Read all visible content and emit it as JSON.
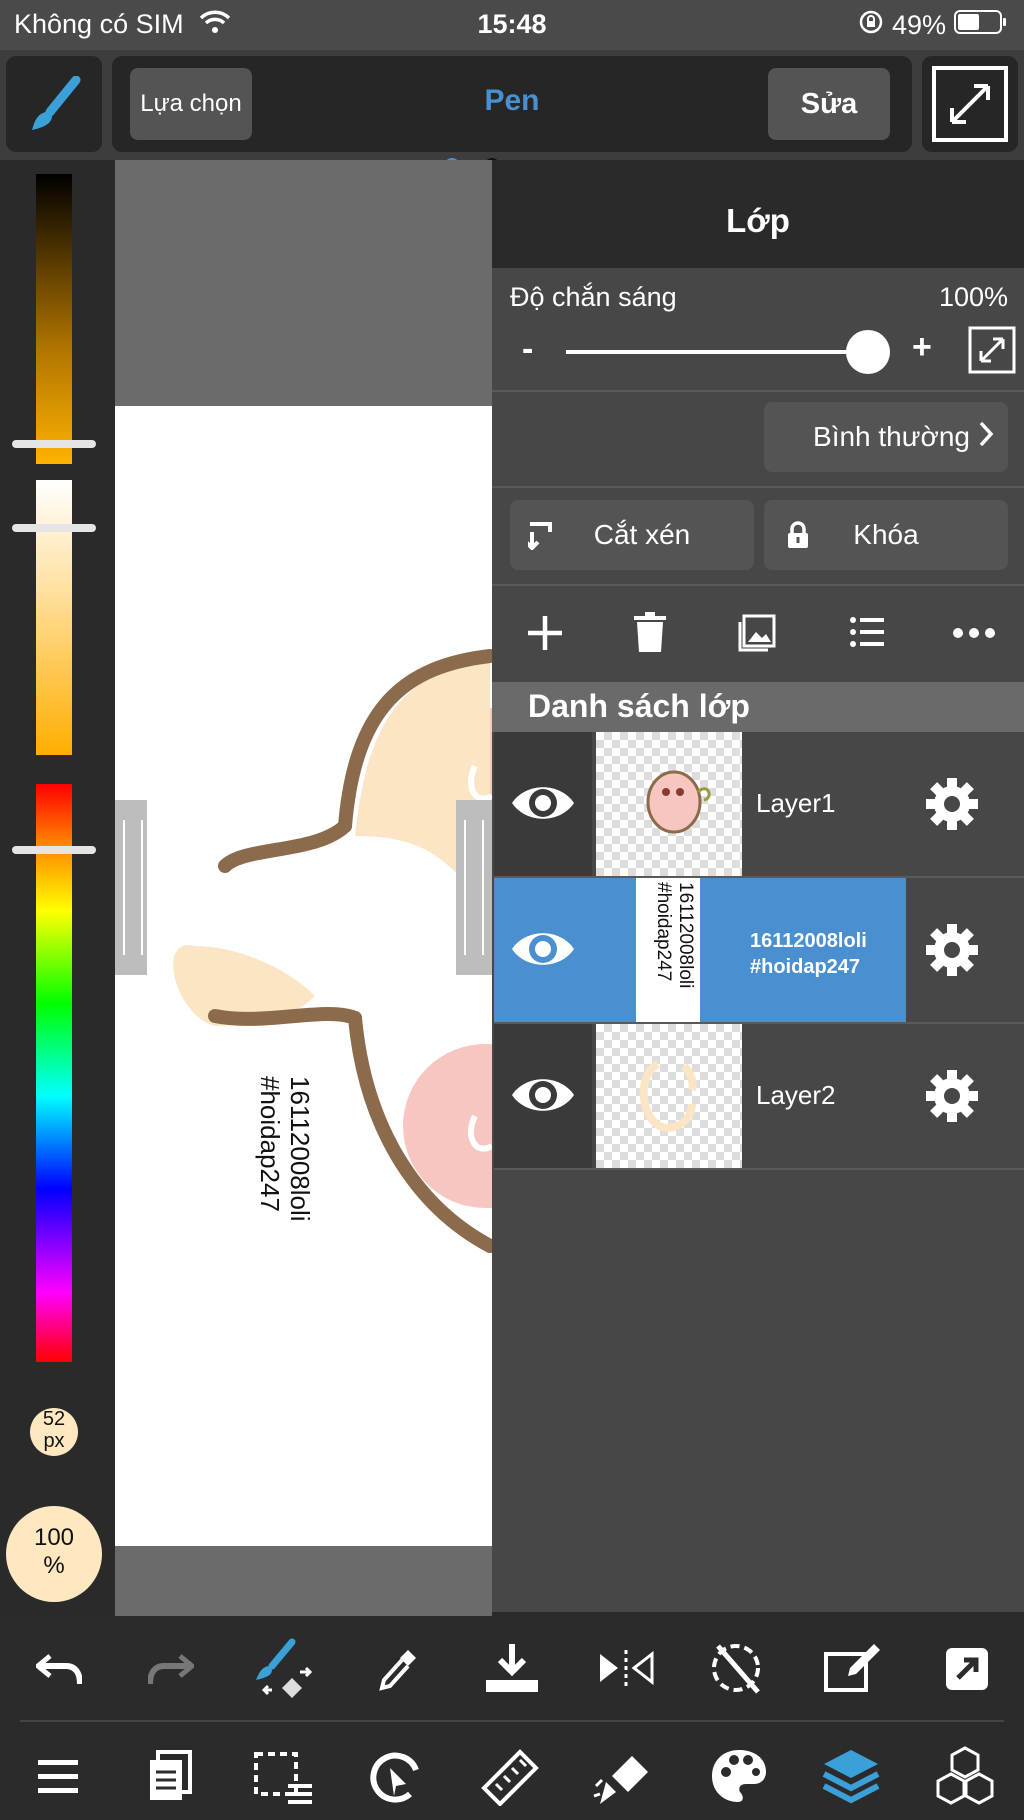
{
  "status": {
    "carrier": "Không có SIM",
    "time": "15:48",
    "battery": "49%"
  },
  "toolbar": {
    "selection_label": "Lựa chọn",
    "tool_label": "Pen",
    "edit_label": "Sửa"
  },
  "brush": {
    "size": "52\npx",
    "opacity": "100\n%"
  },
  "canvas": {
    "text": "16112008loli\n#hoidap247"
  },
  "panel": {
    "title": "Lớp",
    "opacity_label": "Độ chắn sáng",
    "opacity_value": "100%",
    "opacity_level": 1.0,
    "minus": "-",
    "plus": "+",
    "blend_mode": "Bình thường",
    "clip_label": "Cắt xén",
    "lock_label": "Khóa",
    "list_header": "Danh sách lớp",
    "layers": [
      {
        "name": "Layer1",
        "selected": false
      },
      {
        "name": "16112008loli\n#hoidap247",
        "selected": true,
        "thumb_text": "16112008loli\n#hoidap247"
      },
      {
        "name": "Layer2",
        "selected": false
      }
    ]
  },
  "colors": {
    "accent": "#4a90d0",
    "selected_row": "#4a90d0",
    "panel": "#474747",
    "canvas_bg": "#6b6b6b",
    "brush_blue": "#3b9fd8"
  },
  "icons": {
    "top": [
      "brush-icon",
      "fullscreen-icon"
    ],
    "bottom_row1": [
      "undo-icon",
      "redo-icon",
      "brush-swap-icon",
      "eyedropper-icon",
      "save-icon",
      "flip-icon",
      "rotate-off-icon",
      "edit-layer-icon",
      "export-icon"
    ],
    "bottom_row2": [
      "menu-icon",
      "pages-icon",
      "selection-icon",
      "transform-icon",
      "ruler-icon",
      "fill-icon",
      "palette-icon",
      "layers-icon",
      "materials-icon"
    ]
  }
}
